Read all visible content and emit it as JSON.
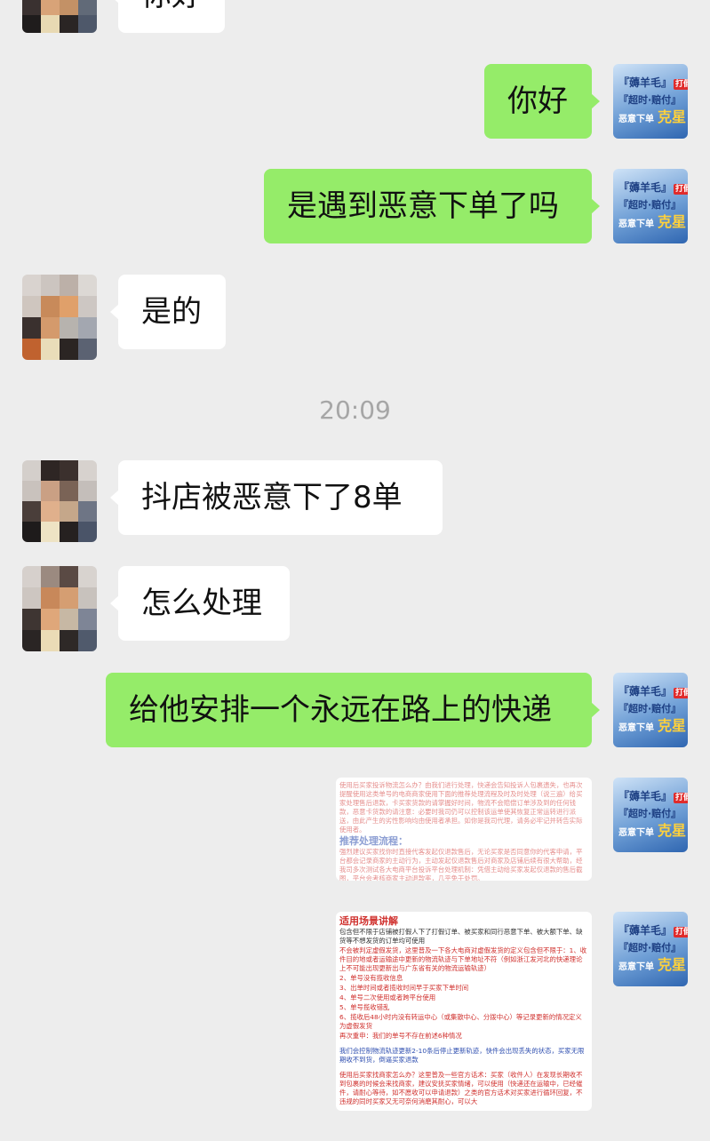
{
  "chat": {
    "messages": [
      {
        "dir": "in",
        "text": "你好"
      },
      {
        "dir": "out",
        "text": "你好"
      },
      {
        "dir": "out",
        "text": "是遇到恶意下单了吗"
      },
      {
        "dir": "in",
        "text": "是的"
      },
      {
        "dir": "in",
        "text": "抖店被恶意下了8单"
      },
      {
        "dir": "in",
        "text": "怎么处理"
      },
      {
        "dir": "out",
        "text": "给他安排一个永远在路上的快递"
      }
    ],
    "timestamp": "20:09"
  },
  "brand_avatar": {
    "line1": "『薅羊毛』",
    "tag": "打假人",
    "line2": "『超时·赔付』",
    "line3": "恶意下单",
    "line3_big": "克星"
  },
  "doc1": {
    "p1": "使用后买家投诉物流怎么办？由我们进行处理，快递会告知投诉人包裹遗失，也再次提醒使用这类单号的电商商家使用下面的推荐处理流程及时及时处理（说三遍）给买家处理售后退款，卡买家货款的请掌握好时间，物流不会赔偿订单涉及到的任何钱款，恶意卡货款的请注意：必要时我司仍可以控制该运单使其恢复正常运转进行派送，由此产生的劣性影响均由使用者承担。如你是我司代理，请务必牢记并转告实际使用者。",
    "heading": "推荐处理流程：",
    "p2": "强烈建议买家找你时直接代客发起仅退款售后，无论买家是否同意你的代客申请，平台都会记录商家的主动行为，主动发起仅退款售后对商家及店铺后续有很大帮助，经我司多次测试各大电商平台投诉平台处理机制：凭借主动给买家发起仅退款的售后截图，平台会考核商家主动退款率，几乎免于处罚。"
  },
  "doc2": {
    "heading": "适用场景讲解",
    "p1": "包含但不限于店铺被打假人下了打假订单、被买家和同行恶意下单、被大额下单、缺货等不想发货的订单均可使用",
    "p2": "不会被判定虚假发货，这里普及一下各大电商对虚假发货的定义包含但不限于：1、收件目的地或者运输途中更新的物流轨迹与下单地址不符（例如浙江发河北的快递理论上不可能出现更新出与广东省有关的物流运输轨迹）",
    "p3": "2、单号没有揽收信息",
    "p4": "3、出单时间或者揽收时间早于买家下单时间",
    "p5": "4、单号二次使用或者跨平台使用",
    "p6": "5、单号揽收错乱",
    "p7": "6、揽收后48小时内没有转运中心（或集散中心、分拨中心）等记录更新的情况定义为虚假发货",
    "p8": "再次重申：我们的单号不存在前述6种情况",
    "p9": "我们会控制物流轨迹更新2-10条后停止更新轨迹，快件会出现丢失的状态，买家无限期收不到货，倒逼买家退款",
    "p10": "使用后买家找商家怎么办？这里普及一些官方话术：买家（收件人）在发现长期收不到包裹的时候会来找商家，建议安抚买家情绪，可以使用（快递还在运输中，已经催件，请耐心等待，如不愿收可以申请退款）之类的官方话术对买家进行循环回复，不违规的同时买家又无可奈何消磨其耐心，可以大"
  },
  "colors": {
    "bubble_out": "#95ec69",
    "bubble_in": "#ffffff",
    "background": "#ededed"
  }
}
